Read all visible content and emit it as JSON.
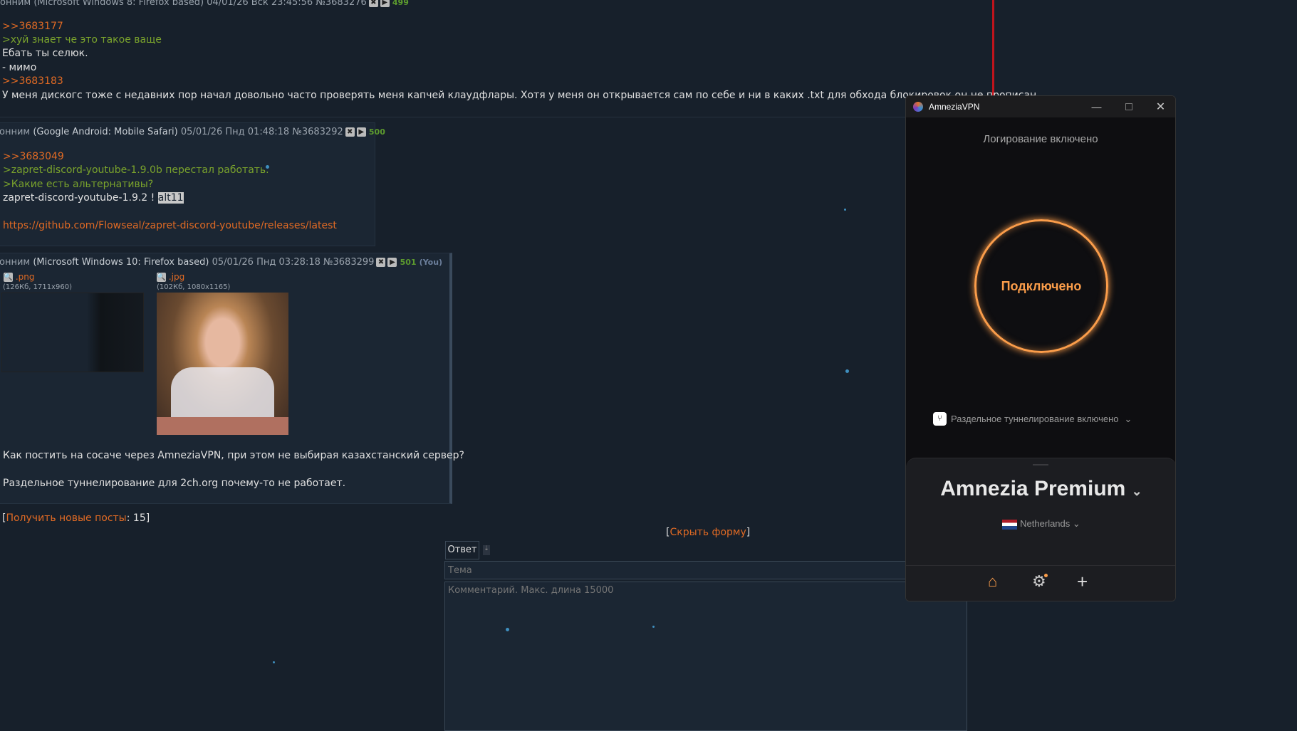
{
  "posts": [
    {
      "header": "онним (Microsoft Windows 8: Firefox based) 04/01/26 Вск 23:45:56 №3683276",
      "number": "499",
      "lines": [
        ">>3683177",
        ">хуй знает че это такое ваще",
        "Ебать ты селюк.",
        "- мимо",
        ">>3683183",
        "У меня дискогс тоже с недавних пор начал довольно часто проверять меня капчей клаудфлары. Хотя у меня он открывается сам по себе и ни в каких .txt для обхода блокировок он не прописан"
      ]
    },
    {
      "author": "онним",
      "agent": "(Google Android: Mobile Safari)",
      "date": "05/01/26 Пнд 01:48:18 №3683292",
      "number": "500",
      "reply": ">>3683049",
      "quote1": ">zapret-discord-youtube-1.9.0b перестал работать.",
      "quote2": ">Какие есть альтернативы?",
      "text": "zapret-discord-youtube-1.9.2 !",
      "highlight": "alt11",
      "link": "https://github.com/Flowseal/zapret-discord-youtube/releases/latest"
    },
    {
      "author": "онним",
      "agent": "(Microsoft Windows 10: Firefox based)",
      "date": "05/01/26 Пнд 03:28:18 №3683299",
      "number": "501",
      "you": "(You)",
      "files": [
        {
          "name": ".png",
          "info": "(126Кб, 1711x960)"
        },
        {
          "name": ".jpg",
          "info": "(102Кб, 1080x1165)"
        }
      ],
      "text1": "Как постить на сосаче через AmneziaVPN, при этом не выбирая казахстанский сервер?",
      "text2": "Раздельное туннелирование для 2ch.org почему-то не работает."
    }
  ],
  "get_new": {
    "label": "Получить новые посты",
    "count": "15"
  },
  "hide_form": "Скрыть форму",
  "form": {
    "reply_tab": "Ответ",
    "subject_placeholder": "Тема",
    "comment_placeholder": "Комментарий. Макс. длина 15000"
  },
  "vpn": {
    "title": "AmneziaVPN",
    "logging": "Логирование включено",
    "status": "Подключено",
    "split": "Раздельное туннелирование включено",
    "server": "Amnezia Premium",
    "country": "Netherlands",
    "accent": "#fb9d4a"
  }
}
